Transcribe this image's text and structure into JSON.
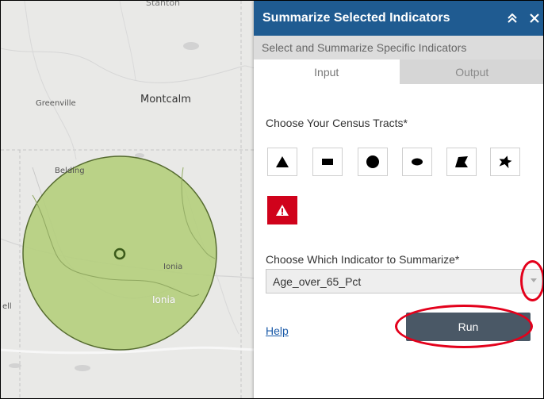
{
  "map": {
    "labels": {
      "stanton": "Stanton",
      "montcalm": "Montcalm",
      "greenville": "Greenville",
      "belding": "Belding",
      "ionia_city": "Ionia",
      "ionia_county": "Ionia",
      "ell": "ell"
    },
    "buffer_fill": "#b5cf7f",
    "buffer_stroke": "#556b2f"
  },
  "panel": {
    "title": "Summarize Selected Indicators",
    "collapse_icon": "double-chevron-up-icon",
    "close_icon": "close-icon",
    "subtitle": "Select and Summarize Specific Indicators",
    "tabs": [
      {
        "label": "Input",
        "active": true
      },
      {
        "label": "Output",
        "active": false
      }
    ],
    "tracts_label": "Choose Your Census Tracts*",
    "draw_tools": [
      {
        "icon": "triangle-icon"
      },
      {
        "icon": "rectangle-icon"
      },
      {
        "icon": "circle-icon"
      },
      {
        "icon": "ellipse-icon"
      },
      {
        "icon": "polygon-icon"
      },
      {
        "icon": "freehand-polygon-icon"
      },
      {
        "icon": "warning-icon"
      }
    ],
    "indicator_label": "Choose Which Indicator to Summarize*",
    "indicator_value": "Age_over_65_Pct",
    "help_label": "Help",
    "run_label": "Run",
    "colors": {
      "header": "#1f5b91",
      "warn": "#d0021b",
      "run": "#4a5866",
      "annotation": "#e3001b"
    }
  }
}
